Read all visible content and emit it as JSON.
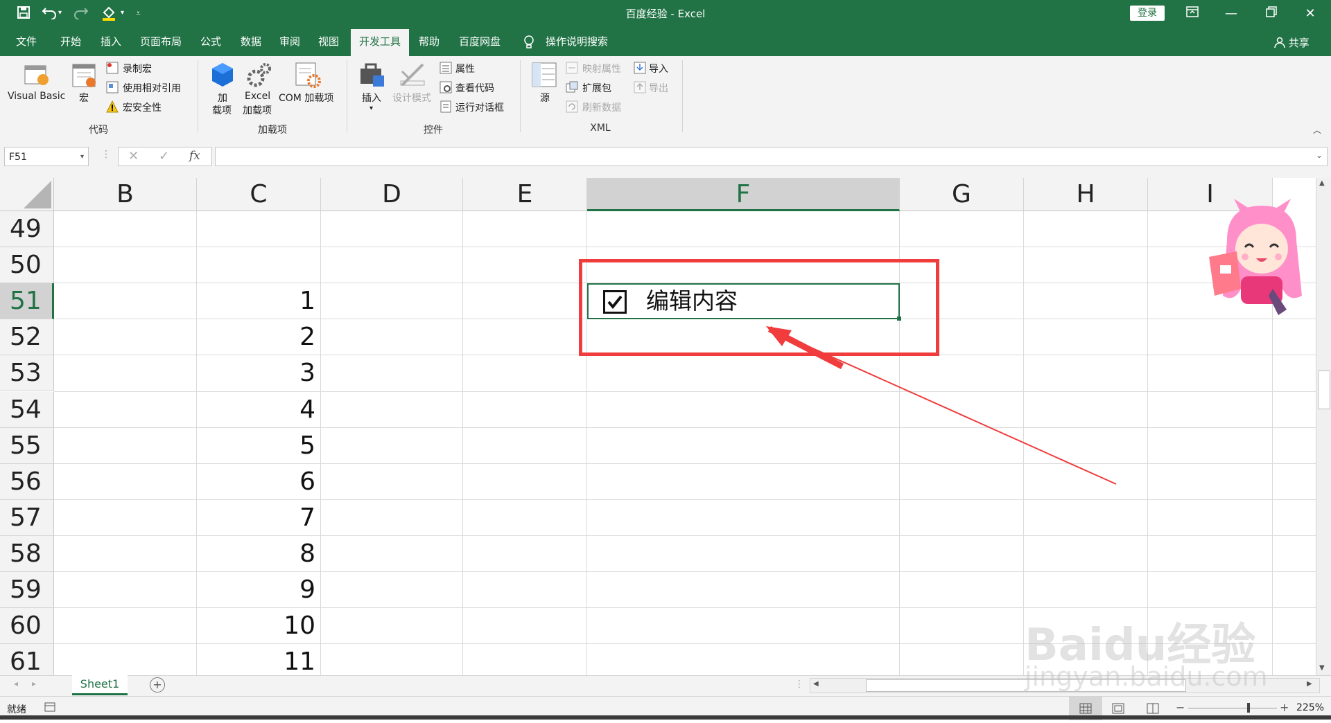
{
  "window": {
    "title": "百度经验  -  Excel",
    "login_label": "登录",
    "share_label": "共享"
  },
  "tabs": [
    {
      "label": "文件"
    },
    {
      "label": "开始"
    },
    {
      "label": "插入"
    },
    {
      "label": "页面布局"
    },
    {
      "label": "公式"
    },
    {
      "label": "数据"
    },
    {
      "label": "审阅"
    },
    {
      "label": "视图"
    },
    {
      "label": "开发工具"
    },
    {
      "label": "帮助"
    },
    {
      "label": "百度网盘"
    },
    {
      "label": "操作说明搜索"
    }
  ],
  "ribbon": {
    "code": {
      "group": "代码",
      "vb": "Visual Basic",
      "macro": "宏",
      "record": "录制宏",
      "relative": "使用相对引用",
      "security": "宏安全性"
    },
    "addins": {
      "group": "加载项",
      "addin1": "加",
      "addin2": "载项",
      "excel1": "Excel",
      "excel2": "加载项",
      "com": "COM 加载项"
    },
    "controls": {
      "group": "控件",
      "insert": "插入",
      "design": "设计模式",
      "props": "属性",
      "viewcode": "查看代码",
      "dialog": "运行对话框"
    },
    "xml": {
      "group": "XML",
      "source": "源",
      "mapprops": "映射属性",
      "expansion": "扩展包",
      "refresh": "刷新数据",
      "import": "导入",
      "export": "导出"
    }
  },
  "formula_bar": {
    "name_box": "F51",
    "fx": "fx",
    "value": ""
  },
  "columns": [
    "B",
    "C",
    "D",
    "E",
    "F",
    "G",
    "H",
    "I"
  ],
  "rows": [
    "49",
    "50",
    "51",
    "52",
    "53",
    "54",
    "55",
    "56",
    "57",
    "58",
    "59",
    "60",
    "61"
  ],
  "c_values": [
    "",
    "",
    "1",
    "2",
    "3",
    "4",
    "5",
    "6",
    "7",
    "8",
    "9",
    "10",
    "11"
  ],
  "checkbox": {
    "label": "编辑内容",
    "checked": true
  },
  "sheet": {
    "name": "Sheet1"
  },
  "status": {
    "ready": "就绪",
    "zoom": "225%"
  },
  "watermark": {
    "line1": "Baidu经验",
    "line2": "jingyan.baidu.com"
  },
  "colors": {
    "excel_green": "#217346",
    "annotation_red": "#f03c3c"
  }
}
